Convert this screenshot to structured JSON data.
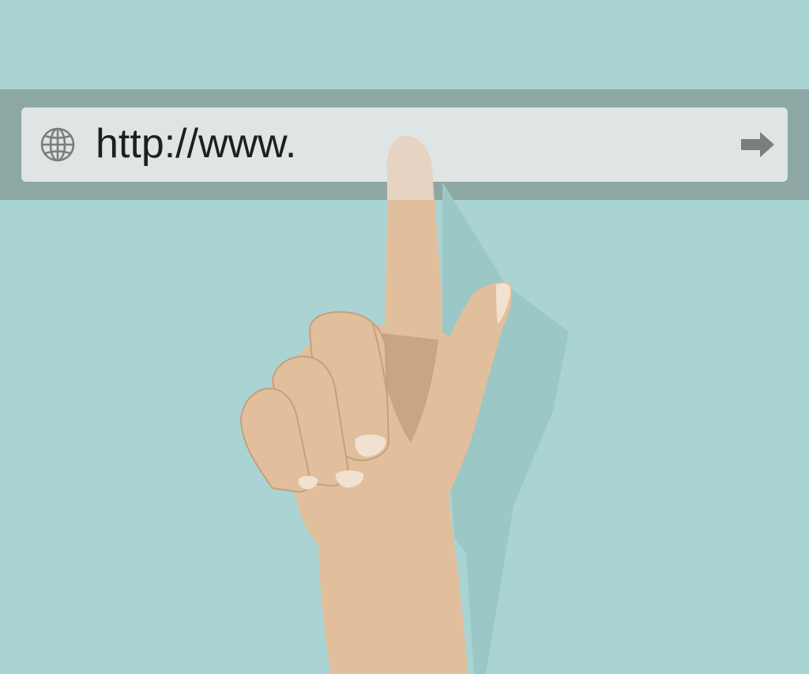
{
  "address_bar": {
    "url_text": "http://www.",
    "leading_icon": "globe-icon",
    "trailing_icon": "arrow-right-icon"
  },
  "illustration": {
    "subject": "hand-pointing-icon"
  },
  "colors": {
    "background": "#a9d4d3",
    "address_band": "#8da7a5",
    "address_field": "#dfe5e4",
    "icon_gray": "#7d7d7d",
    "skin": "#e1bf9d",
    "skin_shadow": "#caa583",
    "nail": "#f1e1d0"
  }
}
